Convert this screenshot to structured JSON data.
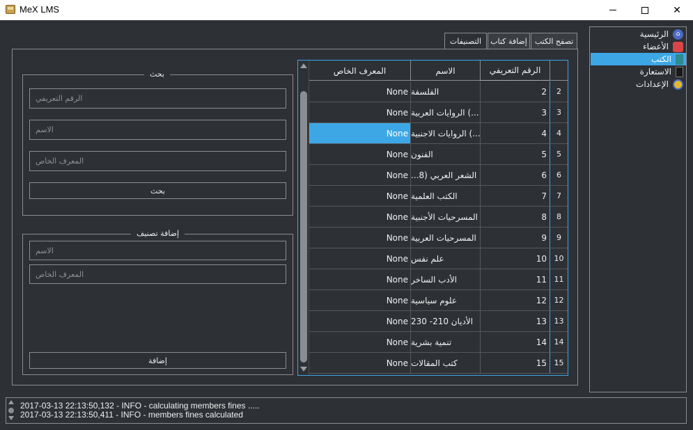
{
  "window": {
    "title": "MeX LMS",
    "minimize_glyph": "",
    "maximize_glyph": "",
    "close_glyph": "✕"
  },
  "sidebar": {
    "items": [
      {
        "label": "الرئيسية",
        "icon": "home-icon",
        "active": false
      },
      {
        "label": "الأعضاء",
        "icon": "members-icon",
        "active": false
      },
      {
        "label": "الكتب",
        "icon": "books-icon",
        "active": true
      },
      {
        "label": "الاستعارة",
        "icon": "borrow-icon",
        "active": false
      },
      {
        "label": "الإعدادات",
        "icon": "settings-icon",
        "active": false
      }
    ]
  },
  "tabs": [
    {
      "label": "تصفح الكتب",
      "active": false
    },
    {
      "label": "إضافة كتاب",
      "active": false
    },
    {
      "label": "التصنيفات",
      "active": true
    }
  ],
  "search_group": {
    "title": "بحث",
    "id_placeholder": "الرقم التعريفي",
    "name_placeholder": "الاسم",
    "special_id_placeholder": "المعرف الخاص",
    "button_label": "بحث"
  },
  "add_group": {
    "title": "إضافة تصنيف",
    "name_placeholder": "الاسم",
    "special_id_placeholder": "المعرف الخاص",
    "button_label": "إضافة"
  },
  "table": {
    "headers": {
      "special_id": "المعرف الخاص",
      "name": "الاسم",
      "id": "الرقم التعريفي"
    },
    "selected_index": 2,
    "rows": [
      {
        "rownum": "2",
        "id": "2",
        "name": "الفلسفة",
        "special_id": "None"
      },
      {
        "rownum": "3",
        "id": "3",
        "name": "...) الروايات العربية",
        "special_id": "None"
      },
      {
        "rownum": "4",
        "id": "4",
        "name": "...) الروايات الاجنبية",
        "special_id": "None"
      },
      {
        "rownum": "5",
        "id": "5",
        "name": "الفنون",
        "special_id": "None"
      },
      {
        "rownum": "6",
        "id": "6",
        "name": "الشعر العربي (8...",
        "special_id": "None"
      },
      {
        "rownum": "7",
        "id": "7",
        "name": "الكتب العلمية",
        "special_id": "None"
      },
      {
        "rownum": "8",
        "id": "8",
        "name": "المسرحيات الأجنبية",
        "special_id": "None"
      },
      {
        "rownum": "9",
        "id": "9",
        "name": "المسرحيات العربية",
        "special_id": "None"
      },
      {
        "rownum": "10",
        "id": "10",
        "name": "علم نفس",
        "special_id": "None"
      },
      {
        "rownum": "11",
        "id": "11",
        "name": "الأدب الساخر",
        "special_id": "None"
      },
      {
        "rownum": "12",
        "id": "12",
        "name": "علوم سياسية",
        "special_id": "None"
      },
      {
        "rownum": "13",
        "id": "13",
        "name": "الأديان 210- 230",
        "special_id": "None"
      },
      {
        "rownum": "14",
        "id": "14",
        "name": "تنمية بشرية",
        "special_id": "None"
      },
      {
        "rownum": "15",
        "id": "15",
        "name": "كتب المقالات",
        "special_id": "None"
      }
    ]
  },
  "log": {
    "lines": [
      "2017-03-13 22:13:50,132 - INFO - calculating members fines .....",
      "2017-03-13 22:13:50,411 - INFO - members fines calculated"
    ]
  },
  "colors": {
    "accent": "#3da7e6",
    "background": "#2d3035",
    "border": "#8a8d92"
  }
}
